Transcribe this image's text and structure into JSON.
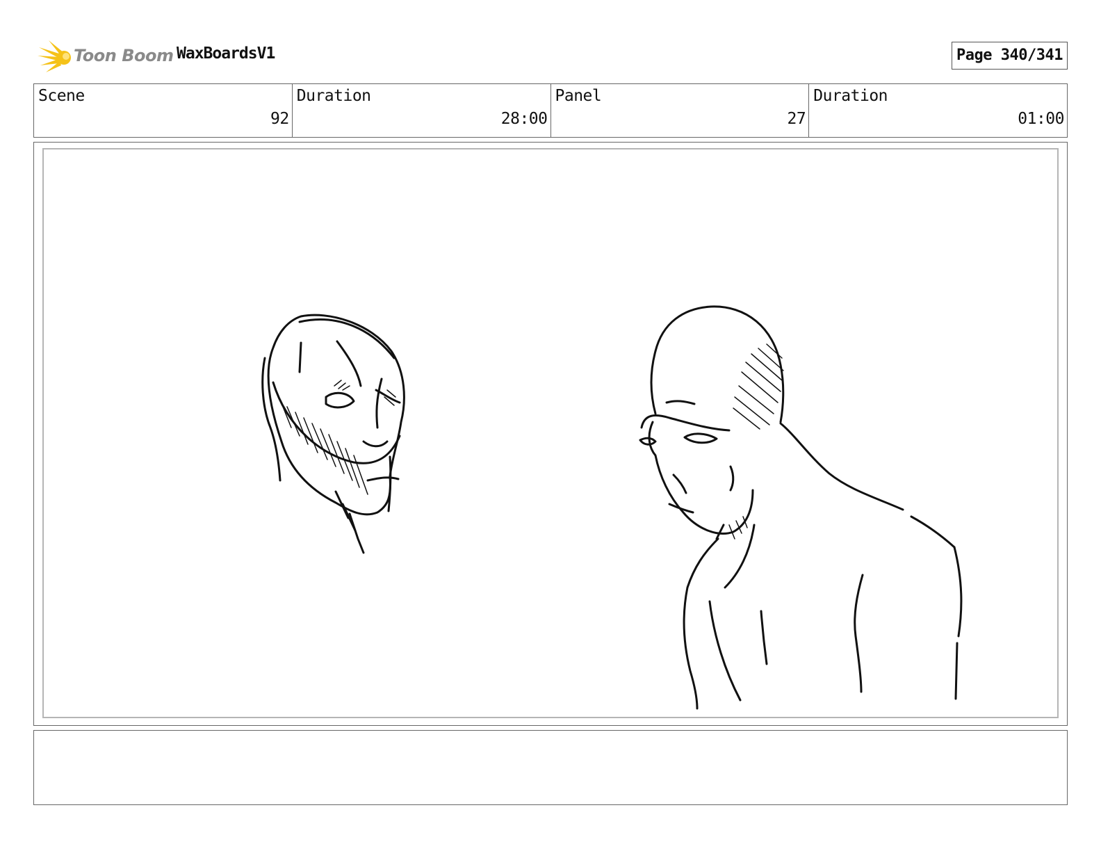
{
  "header": {
    "logo_text": "Toon Boom",
    "project_title": "WaxBoardsV1",
    "page_label": "Page 340/341"
  },
  "info": {
    "scene_label": "Scene",
    "scene_value": "92",
    "scene_duration_label": "Duration",
    "scene_duration_value": "28:00",
    "panel_label": "Panel",
    "panel_value": "27",
    "panel_duration_label": "Duration",
    "panel_duration_value": "01:00"
  },
  "colors": {
    "logo_accent": "#f5c218",
    "logo_text": "#8a8a8a",
    "border": "#666666",
    "sketch": "#111111"
  },
  "icons": {
    "logo": "toon-boom-star-icon"
  },
  "notes": {
    "text": ""
  }
}
